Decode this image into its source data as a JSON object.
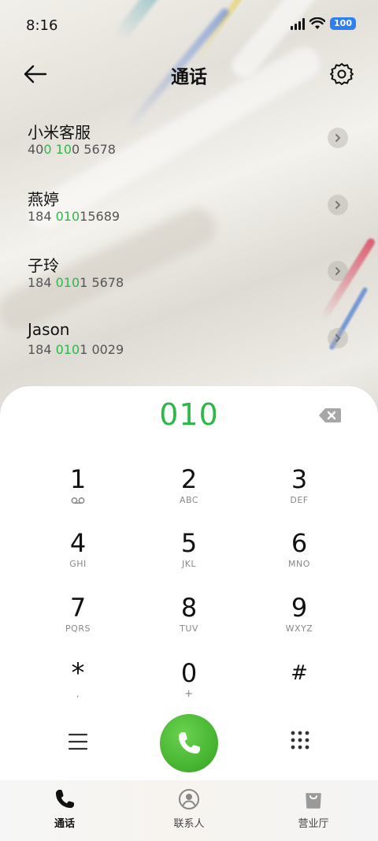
{
  "status_bar": {
    "time": "8:16",
    "battery": "100"
  },
  "header": {
    "title": "通话",
    "back_icon": "arrow-left-icon",
    "settings_icon": "gear-icon"
  },
  "contacts": [
    {
      "name": "小米客服",
      "number_parts": [
        "40",
        "0",
        " ",
        "10",
        "0 5678"
      ],
      "highlight": [
        false,
        true,
        false,
        true,
        false
      ]
    },
    {
      "name": "燕婷",
      "number_parts": [
        "184 ",
        "010",
        "15689"
      ],
      "highlight": [
        false,
        true,
        false
      ]
    },
    {
      "name": "子玲",
      "number_parts": [
        "184 ",
        "010",
        "1 5678"
      ],
      "highlight": [
        false,
        true,
        false
      ]
    },
    {
      "name": "Jason",
      "number_parts": [
        "184 ",
        "010",
        "1 0029"
      ],
      "highlight": [
        false,
        true,
        false
      ]
    }
  ],
  "dialer": {
    "input": "010",
    "keys": [
      {
        "digit": "1",
        "sub": "voicemail-icon"
      },
      {
        "digit": "2",
        "sub": "ABC"
      },
      {
        "digit": "3",
        "sub": "DEF"
      },
      {
        "digit": "4",
        "sub": "GHI"
      },
      {
        "digit": "5",
        "sub": "JKL"
      },
      {
        "digit": "6",
        "sub": "MNO"
      },
      {
        "digit": "7",
        "sub": "PQRS"
      },
      {
        "digit": "8",
        "sub": "TUV"
      },
      {
        "digit": "9",
        "sub": "WXYZ"
      },
      {
        "digit": "*",
        "sub": ","
      },
      {
        "digit": "0",
        "sub": "+"
      },
      {
        "digit": "#",
        "sub": ""
      }
    ]
  },
  "bottom_nav": {
    "items": [
      {
        "label": "通话",
        "icon": "phone-icon",
        "active": true
      },
      {
        "label": "联系人",
        "icon": "person-icon",
        "active": false
      },
      {
        "label": "营业厅",
        "icon": "shopping-bag-icon",
        "active": false
      }
    ]
  },
  "colors": {
    "accent_green": "#2db84a",
    "call_button": "#43b12f",
    "battery_blue": "#2f7ff0"
  }
}
